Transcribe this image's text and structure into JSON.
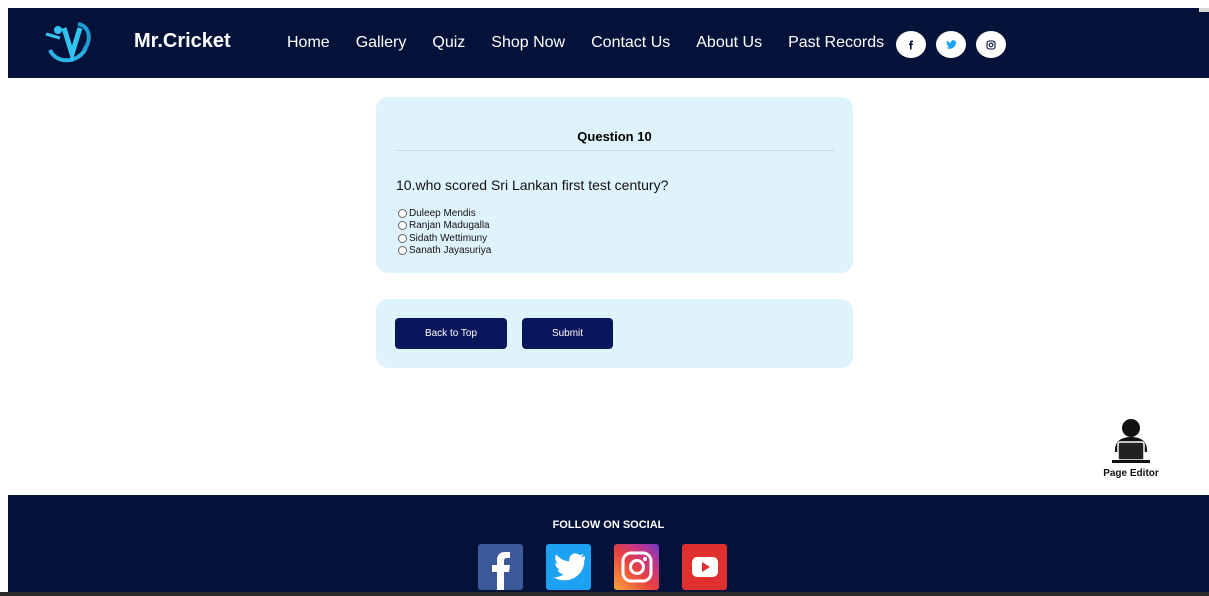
{
  "header": {
    "brand": "Mr.Cricket",
    "nav": [
      "Home",
      "Gallery",
      "Quiz",
      "Shop Now",
      "Contact Us",
      "About Us",
      "Past Records"
    ],
    "social": [
      "f",
      "twitter",
      "instagram"
    ]
  },
  "question": {
    "title": "Question 10",
    "text": "10.who scored Sri Lankan first test century?",
    "options": [
      "Duleep Mendis",
      "Ranjan Madugalla",
      "Sidath Wettimuny",
      "Sanath Jayasuriya"
    ]
  },
  "buttons": {
    "back_to_top": "Back to Top",
    "submit": "Submit"
  },
  "editor": {
    "label": "Page Editor"
  },
  "footer": {
    "title": "FOLLOW ON SOCIAL",
    "icons": [
      "facebook-icon",
      "twitter-icon",
      "instagram-icon",
      "youtube-icon"
    ]
  },
  "colors": {
    "navy": "#04123a",
    "card": "#dff3fc",
    "button": "#0a165c",
    "facebook": "#3b5998",
    "twitter": "#1da1f2",
    "youtube": "#e02f2f"
  }
}
